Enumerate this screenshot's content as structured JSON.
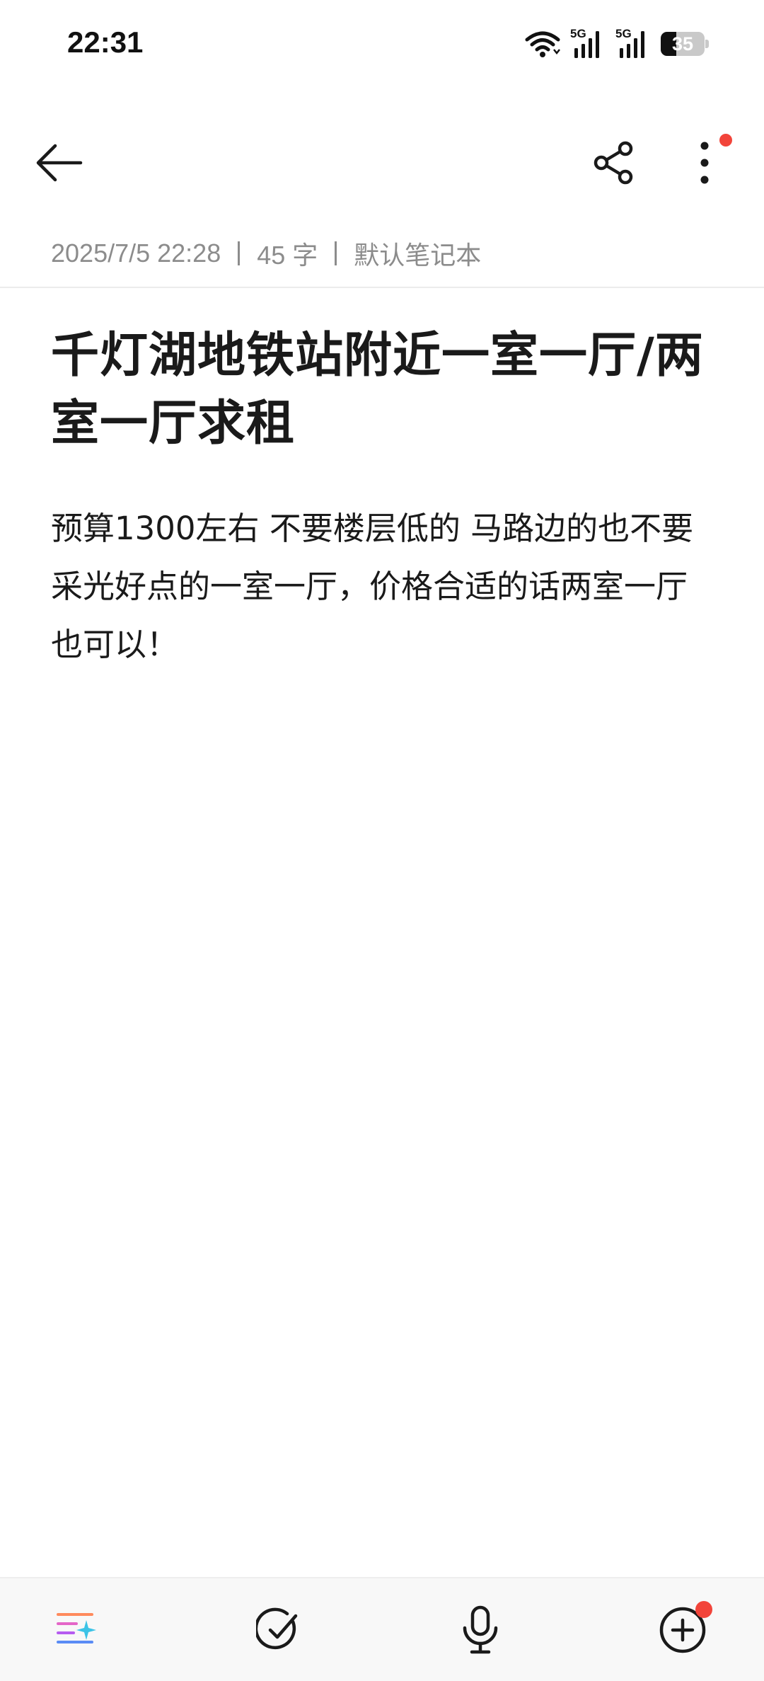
{
  "status_bar": {
    "time": "22:31",
    "network_1": "5G",
    "network_2": "5G",
    "battery_level": "35",
    "battery_fraction": 0.35
  },
  "toolbar": {
    "back_icon": "arrow-left-icon",
    "share_icon": "share-icon",
    "more_icon": "more-vertical-icon",
    "more_has_badge": true
  },
  "note": {
    "date": "2025/7/5 22:28",
    "word_count": "45 字",
    "notebook": "默认笔记本",
    "title": "千灯湖地铁站附近一室一厅/两室一厅求租",
    "body": "预算1300左右 不要楼层低的 马路边的也不要 采光好点的一室一厅，价格合适的话两室一厅也可以！"
  },
  "bottom_bar": {
    "items": [
      {
        "icon": "ai-list-sparkle-icon"
      },
      {
        "icon": "check-circle-icon"
      },
      {
        "icon": "microphone-icon"
      },
      {
        "icon": "add-circle-icon",
        "has_badge": true
      }
    ]
  },
  "colors": {
    "text_primary": "#1a1a1a",
    "text_meta": "#8c8c8c",
    "badge_red": "#f2443a",
    "bottom_bar_bg": "#f8f8f8"
  }
}
